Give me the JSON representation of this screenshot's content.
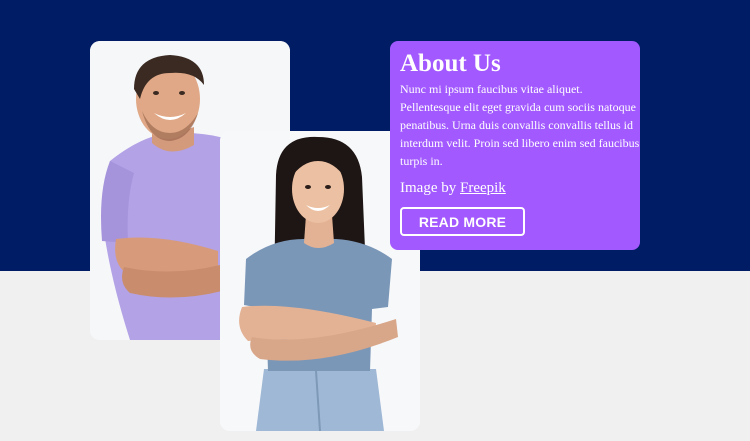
{
  "about": {
    "title": "About Us",
    "body": "Nunc mi ipsum faucibus vitae aliquet. Pellentesque elit eget gravida cum sociis natoque penatibus. Urna duis convallis convallis tellus id interdum velit. Proin sed libero enim sed faucibus turpis in.",
    "credit_prefix": "Image by ",
    "credit_link": "Freepik",
    "button_label": "READ MORE"
  },
  "colors": {
    "band": "#001c64",
    "page_background": "#f0f0f0",
    "card_accent": "#a259ff",
    "text": "#ffffff"
  },
  "images": {
    "left": "smiling-man-purple-tshirt-photo",
    "right": "smiling-woman-blue-tshirt-photo"
  }
}
